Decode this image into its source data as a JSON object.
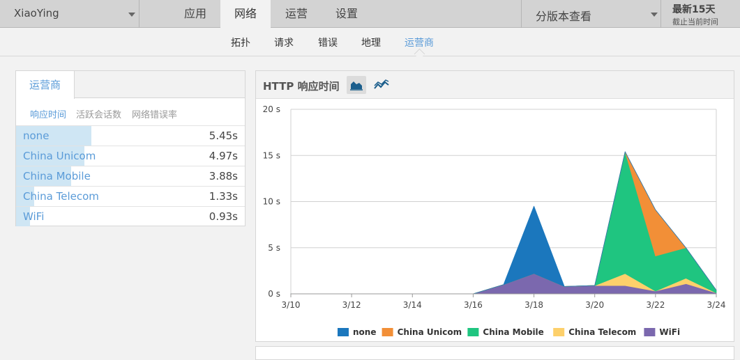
{
  "topnav": {
    "app_name": "XiaoYing",
    "tabs": [
      {
        "label": "应用",
        "active": false
      },
      {
        "label": "网络",
        "active": true
      },
      {
        "label": "运营",
        "active": false
      },
      {
        "label": "设置",
        "active": false
      }
    ],
    "version_label": "分版本查看",
    "range_title": "最新15天",
    "range_sub": "截止当前时间"
  },
  "subnav": {
    "tabs": [
      {
        "label": "拓扑",
        "active": false
      },
      {
        "label": "请求",
        "active": false
      },
      {
        "label": "错误",
        "active": false
      },
      {
        "label": "地理",
        "active": false
      },
      {
        "label": "运营商",
        "active": true
      }
    ]
  },
  "left_panel": {
    "tab": "运营商",
    "metrics": [
      {
        "label": "响应时间",
        "active": true
      },
      {
        "label": "活跃会话数",
        "active": false
      },
      {
        "label": "网络错误率",
        "active": false
      }
    ],
    "rows": [
      {
        "name": "none",
        "value": "5.45s",
        "fraction": 0.33
      },
      {
        "name": "China Unicom",
        "value": "4.97s",
        "fraction": 0.3
      },
      {
        "name": "China Mobile",
        "value": "3.88s",
        "fraction": 0.24
      },
      {
        "name": "China Telecom",
        "value": "1.33s",
        "fraction": 0.08
      },
      {
        "name": "WiFi",
        "value": "0.93s",
        "fraction": 0.06
      }
    ]
  },
  "chart_panel": {
    "title": "HTTP 响应时间",
    "icons": {
      "area": "area-chart-icon",
      "line": "line-chart-icon"
    }
  },
  "chart_data": {
    "type": "area",
    "stacked": true,
    "x": [
      "3/10",
      "3/11",
      "3/12",
      "3/13",
      "3/14",
      "3/15",
      "3/16",
      "3/17",
      "3/18",
      "3/19",
      "3/20",
      "3/21",
      "3/22",
      "3/23",
      "3/24"
    ],
    "x_tick_labels": [
      "3/10",
      "3/12",
      "3/14",
      "3/16",
      "3/18",
      "3/20",
      "3/22",
      "3/24"
    ],
    "y_tick_labels": [
      "0 s",
      "5 s",
      "10 s",
      "15 s",
      "20 s"
    ],
    "ylim": [
      0,
      20
    ],
    "grid": true,
    "legend_position": "bottom",
    "series": [
      {
        "name": "WiFi",
        "color": "#7b68ae",
        "values": [
          0,
          0,
          0,
          0,
          0,
          0,
          0,
          1.0,
          2.2,
          0.8,
          0.9,
          0.9,
          0.3,
          1.1,
          0.1
        ]
      },
      {
        "name": "China Telecom",
        "color": "#fdd06b",
        "values": [
          0,
          0,
          0,
          0,
          0,
          0,
          0,
          0,
          0,
          0,
          0,
          1.3,
          0,
          0.6,
          0
        ]
      },
      {
        "name": "China Mobile",
        "color": "#1fc580",
        "values": [
          0,
          0,
          0,
          0,
          0,
          0,
          0,
          0,
          0,
          0,
          0,
          13.2,
          3.8,
          3.3,
          0.3
        ]
      },
      {
        "name": "China Unicom",
        "color": "#f28f37",
        "values": [
          0,
          0,
          0,
          0,
          0,
          0,
          0,
          0,
          0,
          0,
          0,
          0,
          5.0,
          0,
          0
        ]
      },
      {
        "name": "none",
        "color": "#1b77bd",
        "values": [
          0,
          0,
          0,
          0,
          0,
          0,
          0,
          0,
          7.3,
          0,
          0,
          0,
          0,
          0,
          0
        ]
      }
    ],
    "legend_order": [
      "none",
      "China Unicom",
      "China Mobile",
      "China Telecom",
      "WiFi"
    ]
  }
}
